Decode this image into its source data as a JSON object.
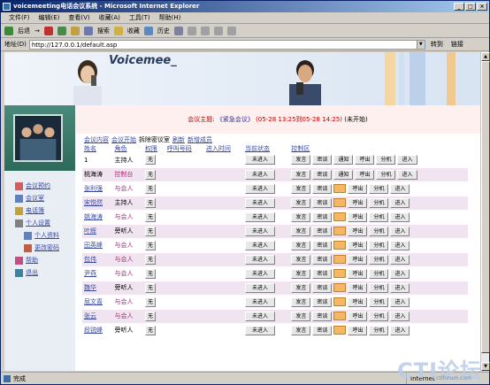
{
  "window": {
    "title": "voicemeeting电话会议系统 - Microsoft Internet Explorer"
  },
  "menu": [
    "文件(F)",
    "编辑(E)",
    "查看(V)",
    "收藏(A)",
    "工具(T)",
    "帮助(H)"
  ],
  "toolbar": {
    "back": "后退",
    "search": "搜索",
    "favorites": "收藏",
    "history": "历史"
  },
  "address": {
    "label": "地址(D)",
    "url": "http://127.0.0.1/default.asp",
    "go": "转到",
    "links": "链接"
  },
  "banner": {
    "title": "Voicemee_"
  },
  "sidebar": {
    "items": [
      {
        "label": "会议预约",
        "link": true
      },
      {
        "label": "会议室",
        "link": true
      },
      {
        "label": "电话簿",
        "link": true
      },
      {
        "label": "个人设置",
        "link": true
      },
      {
        "label": "个人资料",
        "link": true
      },
      {
        "label": "更改密码",
        "link": true
      },
      {
        "label": "帮助",
        "link": true
      },
      {
        "label": "退出",
        "link": true
      }
    ]
  },
  "meeting": {
    "label": "会议主题:",
    "name": "《紧急会议》",
    "time": "(05-28 13:25到05-28 14:25)",
    "state": "(未开始)"
  },
  "actions": {
    "content": "会议内容",
    "start": "会议开始",
    "unlock": "拆除密议室",
    "refresh": "刷新",
    "add": "新增成员"
  },
  "table": {
    "headers": [
      "姓名",
      "角色",
      "权限",
      "呼叫号码",
      "进入时间",
      "当前状态",
      "控制区"
    ],
    "rows": [
      {
        "name": "1",
        "role": "主持人",
        "perm": "无",
        "status": "未进入",
        "link": false,
        "roleClass": "host",
        "lock": false
      },
      {
        "name": "桃海涛",
        "role": "控制台",
        "perm": "无",
        "status": "未进入",
        "link": false,
        "roleClass": "ctrl",
        "lock": false
      },
      {
        "name": "张利强",
        "role": "与会人",
        "perm": "无",
        "status": "未进入",
        "link": true,
        "roleClass": "part",
        "lock": true
      },
      {
        "name": "宋悦然",
        "role": "主持人",
        "perm": "无",
        "status": "未进入",
        "link": true,
        "roleClass": "host",
        "lock": true
      },
      {
        "name": "姚海涛",
        "role": "与会人",
        "perm": "无",
        "status": "未进入",
        "link": true,
        "roleClass": "part",
        "lock": true
      },
      {
        "name": "叶辉",
        "role": "旁听人",
        "perm": "无",
        "status": "未进入",
        "link": true,
        "roleClass": "list",
        "lock": true
      },
      {
        "name": "田英峰",
        "role": "与会人",
        "perm": "无",
        "status": "未进入",
        "link": true,
        "roleClass": "part",
        "lock": true
      },
      {
        "name": "包伟",
        "role": "与会人",
        "perm": "无",
        "status": "未进入",
        "link": true,
        "roleClass": "part",
        "lock": true
      },
      {
        "name": "尹燕",
        "role": "与会人",
        "perm": "无",
        "status": "未进入",
        "link": true,
        "roleClass": "part",
        "lock": true
      },
      {
        "name": "魏华",
        "role": "旁听人",
        "perm": "无",
        "status": "未进入",
        "link": true,
        "roleClass": "list",
        "lock": true
      },
      {
        "name": "屈文喜",
        "role": "与会人",
        "perm": "无",
        "status": "未进入",
        "link": true,
        "roleClass": "part",
        "lock": true
      },
      {
        "name": "张云",
        "role": "与会人",
        "perm": "无",
        "status": "未进入",
        "link": true,
        "roleClass": "part",
        "lock": true
      },
      {
        "name": "段锐峰",
        "role": "旁听人",
        "perm": "无",
        "status": "未进入",
        "link": true,
        "roleClass": "list",
        "lock": true
      }
    ],
    "controls": {
      "speak": "发言",
      "mute": "密谈",
      "notify": "通知",
      "call": "呼出",
      "split": "分机",
      "enter": "进入"
    }
  },
  "status": {
    "text": "完成",
    "zone": "Internet"
  },
  "watermark": {
    "main": "CTI论坛",
    "sub": "ctiforum.com"
  }
}
